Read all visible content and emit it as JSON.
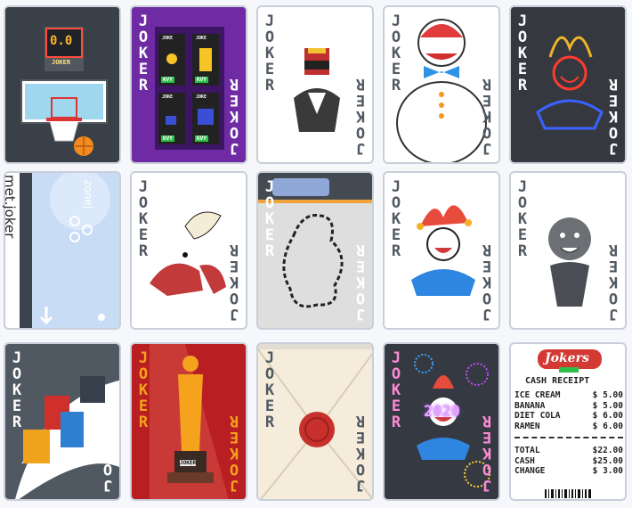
{
  "deck": {
    "label": "JOKER",
    "colors": {
      "dark": "#353b44",
      "ink": "#505862",
      "red": "#c0342c",
      "orange": "#f2a23a",
      "blue": "#2f7fd0",
      "purple": "#6d2aa8",
      "green": "#2fbf4b"
    }
  },
  "cards": [
    {
      "id": "basketball",
      "score": "0.0",
      "brand": "JOKER"
    },
    {
      "id": "arcade-kvy",
      "buttons": [
        "KVY",
        "KVY",
        "KVY",
        "KVY"
      ],
      "tags": [
        "JOKE",
        "JOKE",
        "JOKE",
        "JOKE"
      ]
    },
    {
      "id": "judge-helmet",
      "label": "JOKER"
    },
    {
      "id": "snowman-clown",
      "label": "JOKER"
    },
    {
      "id": "neon-jester",
      "label": "JOKER"
    },
    {
      "id": "met-joker",
      "side_text": "met.joker",
      "zone": "zone|"
    },
    {
      "id": "hermit-crab",
      "label": "JOKER"
    },
    {
      "id": "map-route",
      "label": "JOKER"
    },
    {
      "id": "jester-bells",
      "label": "JOKER"
    },
    {
      "id": "vampire",
      "label": "JOKER"
    },
    {
      "id": "color-blocks",
      "label": "JOKER"
    },
    {
      "id": "golden-statue",
      "label": "JOKER",
      "plaque": "JOKER"
    },
    {
      "id": "envelope-seal",
      "label": "JOKER"
    },
    {
      "id": "fireworks-2020",
      "label": "JOKER",
      "year": "2020"
    },
    {
      "id": "cash-receipt",
      "shop": "Jokers",
      "title": "CASH RECEIPT",
      "items": [
        {
          "name": "ICE CREAM",
          "price": "$ 5.00"
        },
        {
          "name": "BANANA",
          "price": "$ 5.00"
        },
        {
          "name": "DIET COLA",
          "price": "$ 6.00"
        },
        {
          "name": "RAMEN",
          "price": "$ 6.00"
        }
      ],
      "totals": [
        {
          "name": "TOTAL",
          "price": "$22.00"
        },
        {
          "name": "CASH",
          "price": "$25.00"
        },
        {
          "name": "CHANGE",
          "price": "$ 3.00"
        }
      ]
    }
  ]
}
